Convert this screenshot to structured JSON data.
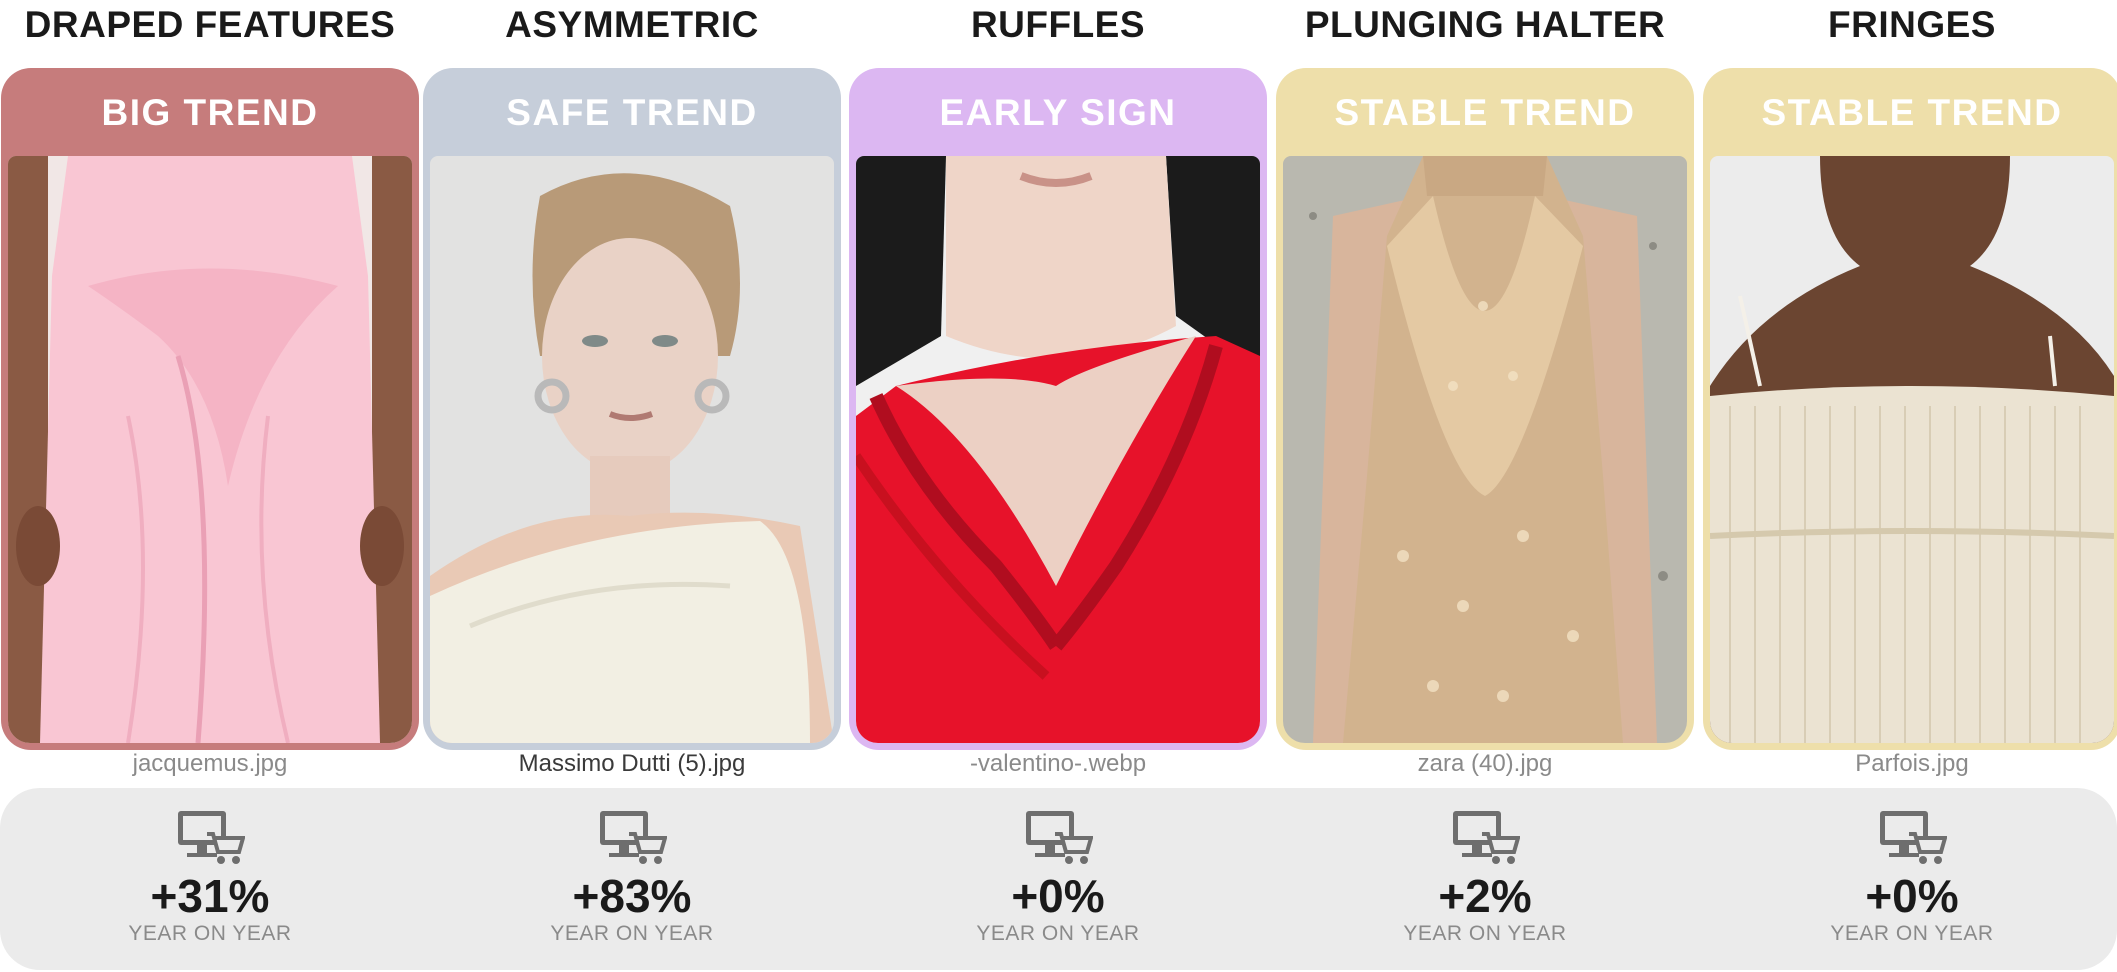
{
  "columns": [
    {
      "title": "DRAPED FEATURES",
      "badge": "BIG TREND",
      "badge_color": "#c67c7c",
      "filename": "jacquemus.jpg",
      "change": "+31%",
      "change_label": "YEAR ON YEAR"
    },
    {
      "title": "ASYMMETRIC",
      "badge": "SAFE TREND",
      "badge_color": "#c6ceda",
      "filename": "Massimo Dutti (5).jpg",
      "change": "+83%",
      "change_label": "YEAR ON YEAR"
    },
    {
      "title": "RUFFLES",
      "badge": "EARLY SIGN",
      "badge_color": "#dcb7f2",
      "filename": "-valentino-.webp",
      "change": "+0%",
      "change_label": "YEAR ON YEAR"
    },
    {
      "title": "PLUNGING HALTER",
      "badge": "STABLE TREND",
      "badge_color": "#eedfaa",
      "filename": "zara (40).jpg",
      "change": "+2%",
      "change_label": "YEAR ON YEAR"
    },
    {
      "title": "FRINGES",
      "badge": "STABLE TREND",
      "badge_color": "#eedfaa",
      "filename": "Parfois.jpg",
      "change": "+0%",
      "change_label": "YEAR ON YEAR"
    }
  ],
  "icons": {
    "stat_icon": "online-shopping-icon"
  }
}
